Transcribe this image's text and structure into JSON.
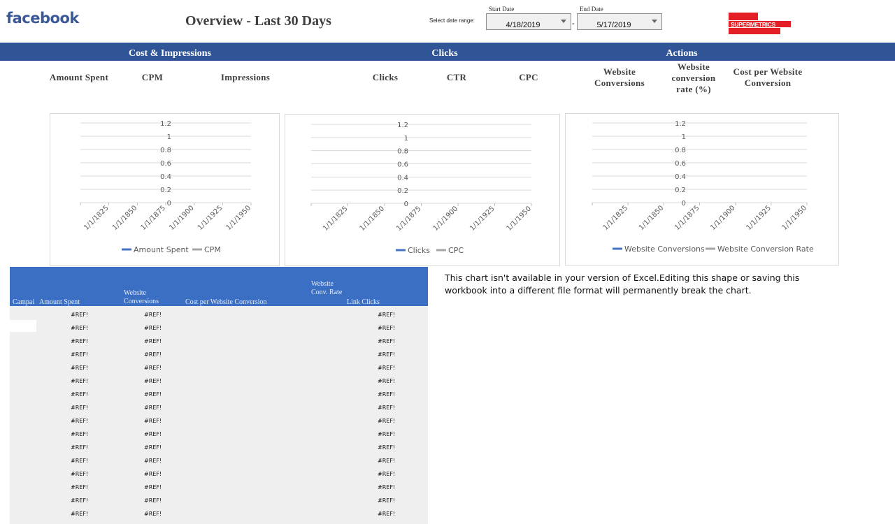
{
  "header": {
    "logo_text": "facebook",
    "title": "Overview - Last 30 Days",
    "date_range_label": "Select date range:",
    "start_caption": "Start Date",
    "start_value": "4/18/2019",
    "separator": "-",
    "end_caption": "End Date",
    "end_value": "5/17/2019",
    "brand_logo": "SUPERMETRICS",
    "brand_color": "#e31e24"
  },
  "sections": [
    "Cost & Impressions",
    "Clicks",
    "Actions"
  ],
  "kpis": [
    "Amount Spent",
    "CPM",
    "Impressions",
    "Clicks",
    "CTR",
    "CPC",
    "Website Conversions",
    "Website conversion rate (%)",
    "Cost per Website Conversion"
  ],
  "chart_data": [
    {
      "type": "line",
      "title": "",
      "categories": [
        "1/1/1825",
        "1/1/1850",
        "1/1/1875",
        "1/1/1900",
        "1/1/1925",
        "1/1/1950"
      ],
      "y_ticks": [
        "0",
        "0.2",
        "0.4",
        "0.6",
        "0.8",
        "1",
        "1.2"
      ],
      "ylim": [
        0,
        1.2
      ],
      "grid": true,
      "legend_position": "bottom",
      "series": [
        {
          "name": "Amount Spent",
          "color": "#4472c4",
          "values": []
        },
        {
          "name": "CPM",
          "color": "#a5a5a5",
          "values": []
        }
      ]
    },
    {
      "type": "line",
      "title": "",
      "categories": [
        "1/1/1825",
        "1/1/1850",
        "1/1/1875",
        "1/1/1900",
        "1/1/1925",
        "1/1/1950"
      ],
      "y_ticks": [
        "0",
        "0.2",
        "0.4",
        "0.6",
        "0.8",
        "1",
        "1.2"
      ],
      "ylim": [
        0,
        1.2
      ],
      "grid": true,
      "legend_position": "bottom",
      "series": [
        {
          "name": "Clicks",
          "color": "#4472c4",
          "values": []
        },
        {
          "name": "CPC",
          "color": "#a5a5a5",
          "values": []
        }
      ]
    },
    {
      "type": "line",
      "title": "",
      "categories": [
        "1/1/1825",
        "1/1/1850",
        "1/1/1875",
        "1/1/1900",
        "1/1/1925",
        "1/1/1950"
      ],
      "y_ticks": [
        "0",
        "0.2",
        "0.4",
        "0.6",
        "0.8",
        "1",
        "1.2"
      ],
      "ylim": [
        0,
        1.2
      ],
      "grid": true,
      "legend_position": "bottom",
      "series": [
        {
          "name": "Website Conversions",
          "color": "#4472c4",
          "values": []
        },
        {
          "name": "Website Conversion Rate",
          "color": "#a5a5a5",
          "values": []
        }
      ]
    }
  ],
  "table": {
    "header_color": "#3a6fc4",
    "columns": {
      "campaign": "Campai",
      "amount_spent": "Amount Spent",
      "website_conversions": "Website Conversions",
      "cost_per_conversion": "Cost per Website Conversion",
      "conv_rate": "Website Conv. Rate",
      "link_clicks": "Link Clicks"
    },
    "rows": [
      {
        "amount": "#REF!",
        "conversions": "#REF!",
        "link_clicks": "#REF!"
      },
      {
        "amount": "#REF!",
        "conversions": "#REF!",
        "link_clicks": "#REF!"
      },
      {
        "amount": "#REF!",
        "conversions": "#REF!",
        "link_clicks": "#REF!"
      },
      {
        "amount": "#REF!",
        "conversions": "#REF!",
        "link_clicks": "#REF!"
      },
      {
        "amount": "#REF!",
        "conversions": "#REF!",
        "link_clicks": "#REF!"
      },
      {
        "amount": "#REF!",
        "conversions": "#REF!",
        "link_clicks": "#REF!"
      },
      {
        "amount": "#REF!",
        "conversions": "#REF!",
        "link_clicks": "#REF!"
      },
      {
        "amount": "#REF!",
        "conversions": "#REF!",
        "link_clicks": "#REF!"
      },
      {
        "amount": "#REF!",
        "conversions": "#REF!",
        "link_clicks": "#REF!"
      },
      {
        "amount": "#REF!",
        "conversions": "#REF!",
        "link_clicks": "#REF!"
      },
      {
        "amount": "#REF!",
        "conversions": "#REF!",
        "link_clicks": "#REF!"
      },
      {
        "amount": "#REF!",
        "conversions": "#REF!",
        "link_clicks": "#REF!"
      },
      {
        "amount": "#REF!",
        "conversions": "#REF!",
        "link_clicks": "#REF!"
      },
      {
        "amount": "#REF!",
        "conversions": "#REF!",
        "link_clicks": "#REF!"
      },
      {
        "amount": "#REF!",
        "conversions": "#REF!",
        "link_clicks": "#REF!"
      },
      {
        "amount": "#REF!",
        "conversions": "#REF!",
        "link_clicks": "#REF!"
      }
    ]
  },
  "notice": "This chart isn't available in your version of Excel.Editing this shape or saving this workbook into a different file format will permanently break the chart."
}
